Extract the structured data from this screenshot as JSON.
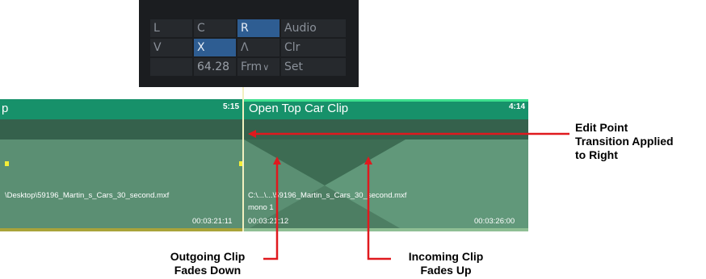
{
  "trim_panel": {
    "row1": [
      "L",
      "C",
      "R",
      "Audio"
    ],
    "row2": [
      "V",
      "X",
      "Λ",
      "Clr"
    ],
    "row3": {
      "value": "64.28",
      "unit": "Frm",
      "set": "Set"
    }
  },
  "timeline": {
    "left_clip": {
      "title": "p",
      "duration": "5:15",
      "path": "\\Desktop\\59196_Martin_s_Cars_30_second.mxf",
      "end_timecode": "00:03:21:11"
    },
    "right_clip": {
      "title": "Open Top Car Clip",
      "duration": "4:14",
      "path": "C:\\...\\...\\59196_Martin_s_Cars_30_second.mxf",
      "audio": "mono 1",
      "start_timecode": "00:03:21:12",
      "end_timecode": "00:03:26:00"
    }
  },
  "annotations": {
    "edit_point": [
      "Edit Point",
      "Transition Applied",
      "to Right"
    ],
    "outgoing": [
      "Outgoing Clip",
      "Fades Down"
    ],
    "incoming": [
      "Incoming Clip",
      "Fades Up"
    ]
  },
  "colors": {
    "arrow": "#e0191e",
    "clip_header": "#17916a",
    "clip_body": "#5b8f73",
    "panel_bg": "#1b1d20",
    "selected": "#2e5d92"
  }
}
